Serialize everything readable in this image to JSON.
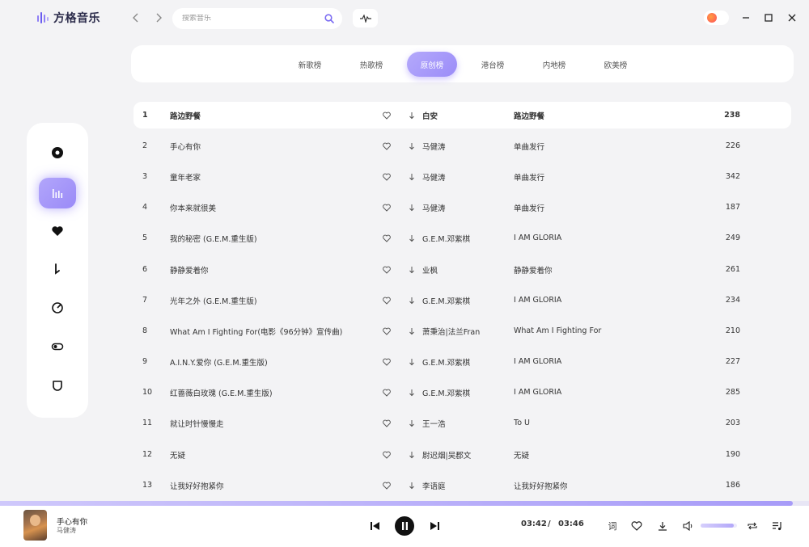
{
  "app": {
    "title": "方格音乐"
  },
  "search": {
    "placeholder": "搜索音乐"
  },
  "tabs": [
    {
      "label": "新歌榜",
      "active": false
    },
    {
      "label": "热歌榜",
      "active": false
    },
    {
      "label": "原创榜",
      "active": true
    },
    {
      "label": "港台榜",
      "active": false
    },
    {
      "label": "内地榜",
      "active": false
    },
    {
      "label": "欧美榜",
      "active": false
    }
  ],
  "sidebar": {
    "items": [
      {
        "icon": "disc-icon",
        "active": false
      },
      {
        "icon": "chart-icon",
        "active": true
      },
      {
        "icon": "heart-icon",
        "active": false
      },
      {
        "icon": "download-icon",
        "active": false
      },
      {
        "icon": "radar-icon",
        "active": false
      },
      {
        "icon": "toggle-icon",
        "active": false
      },
      {
        "icon": "shield-icon",
        "active": false
      }
    ]
  },
  "songs": [
    {
      "num": "1",
      "title": "路边野餐",
      "artist": "白安",
      "album": "路边野餐",
      "count": "238",
      "current": true
    },
    {
      "num": "2",
      "title": "手心有你",
      "artist": "马健涛",
      "album": "单曲发行",
      "count": "226"
    },
    {
      "num": "3",
      "title": "童年老家",
      "artist": "马健涛",
      "album": "单曲发行",
      "count": "342"
    },
    {
      "num": "4",
      "title": "你本来就很美",
      "artist": "马健涛",
      "album": "单曲发行",
      "count": "187"
    },
    {
      "num": "5",
      "title": "我的秘密 (G.E.M.重生版)",
      "artist": "G.E.M.邓紫棋",
      "album": "I AM GLORIA",
      "count": "249"
    },
    {
      "num": "6",
      "title": "静静爱着你",
      "artist": "业枫",
      "album": "静静爱着你",
      "count": "261"
    },
    {
      "num": "7",
      "title": "光年之外 (G.E.M.重生版)",
      "artist": "G.E.M.邓紫棋",
      "album": "I AM GLORIA",
      "count": "234"
    },
    {
      "num": "8",
      "title": "What Am I Fighting For(电影《96分钟》宣传曲)",
      "artist": "萧秉治|法兰Fran",
      "album": "What Am I Fighting For",
      "count": "210"
    },
    {
      "num": "9",
      "title": "A.I.N.Y.爱你 (G.E.M.重生版)",
      "artist": "G.E.M.邓紫棋",
      "album": "I AM GLORIA",
      "count": "227"
    },
    {
      "num": "10",
      "title": "红蔷薇白玫瑰 (G.E.M.重生版)",
      "artist": "G.E.M.邓紫棋",
      "album": "I AM GLORIA",
      "count": "285"
    },
    {
      "num": "11",
      "title": "就让时针慢慢走",
      "artist": "王一浩",
      "album": "To U",
      "count": "203"
    },
    {
      "num": "12",
      "title": "无疑",
      "artist": "尉迟烟|吴郡文",
      "album": "无疑",
      "count": "190"
    },
    {
      "num": "13",
      "title": "让我好好抱紧你",
      "artist": "李语庭",
      "album": "让我好好抱紧你",
      "count": "186"
    }
  ],
  "player": {
    "title": "手心有你",
    "artist": "马健涛",
    "current_time": "03:42",
    "separator": "/",
    "total_time": "03:46",
    "progress": 0.98,
    "volume": 0.9,
    "lyric_label": "词"
  },
  "colors": {
    "accent": "#a394f8",
    "background": "#f3f3f5"
  }
}
